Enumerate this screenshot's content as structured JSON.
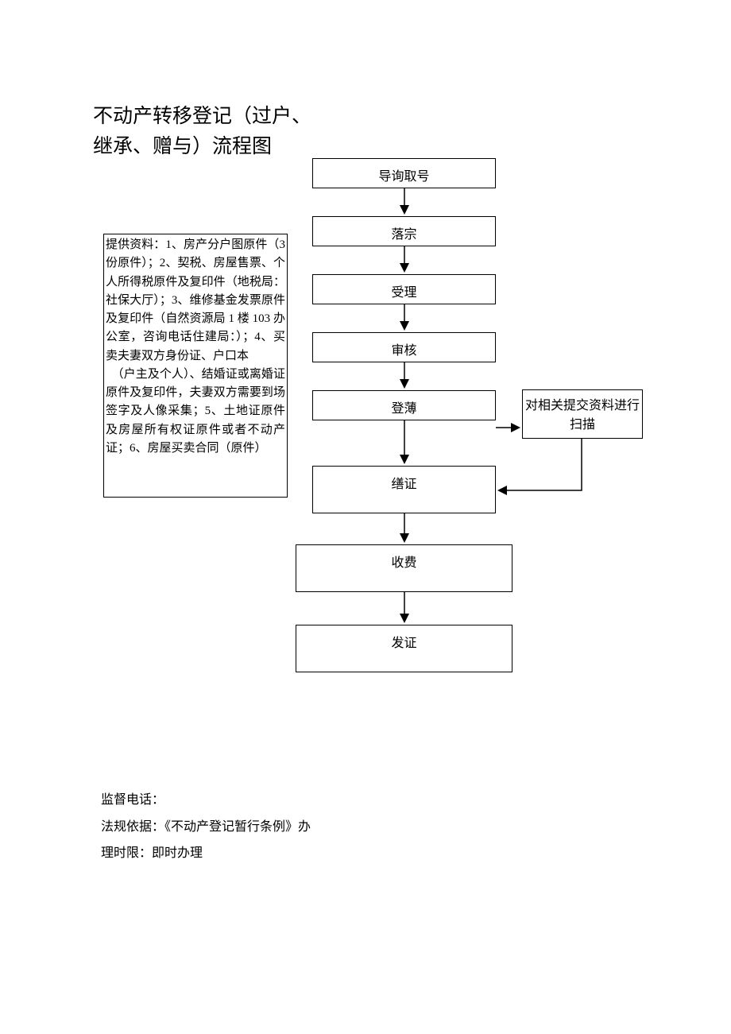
{
  "title": "不动产转移登记（过户、继承、赠与）流程图",
  "materials": "提供资料：1、房产分户图原件（3 份原件）；2、契税、房屋售票、个人所得税原件及复印件（地税局：社保大厅）；3、维修基金发票原件及复印件（自然资源局 1 楼 103 办公室，咨询电话住建局：）；4、买卖夫妻双方身份证、户口本\n　（户主及个人）、结婚证或离婚证原件及复印件，夫妻双方需要到场签字及人像采集；5、土地证原件及房屋所有权证原件或者不动产证；6、房屋买卖合同（原件）",
  "flow": {
    "step1": "导询取号",
    "step2": "落宗",
    "step3": "受理",
    "step4": "审核",
    "step5": "登薄",
    "step6": "缮证",
    "step7": "收费",
    "step8": "发证"
  },
  "sideBox": "对相关提交资料进行扫描",
  "footer": {
    "line1": "监督电话：",
    "line2": "法规依据：《不动产登记暂行条例》办",
    "line3": "理时限：即时办理"
  }
}
